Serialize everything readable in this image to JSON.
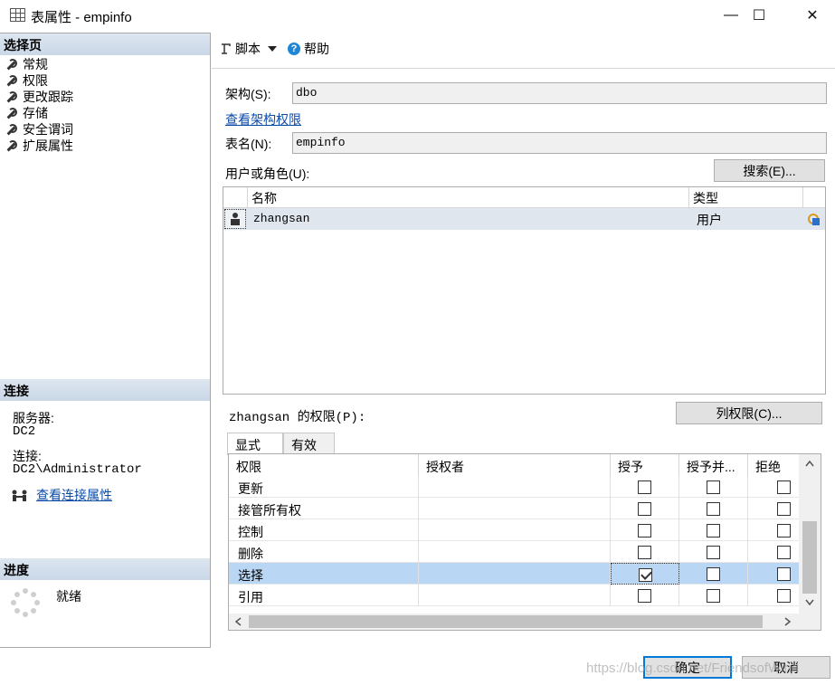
{
  "window": {
    "title": "表属性 - empinfo",
    "minimize_glyph": "—",
    "maximize_glyph": "☐",
    "close_glyph": "✕"
  },
  "left": {
    "select_page_header": "选择页",
    "pages": [
      "常规",
      "权限",
      "更改跟踪",
      "存储",
      "安全谓词",
      "扩展属性"
    ],
    "connection_header": "连接",
    "server_label": "服务器:",
    "server_value": "DC2",
    "connection_label": "连接:",
    "connection_value": "DC2\\Administrator",
    "view_connection_link": "查看连接属性",
    "progress_header": "进度",
    "progress_status": "就绪"
  },
  "toolbar": {
    "script_label": "脚本",
    "help_label": "帮助"
  },
  "form": {
    "schema_label": "架构(S):",
    "schema_value": "dbo",
    "view_schema_permissions_link": "查看架构权限",
    "table_name_label": "表名(N):",
    "table_name_value": "empinfo",
    "users_roles_label": "用户或角色(U):",
    "search_button": "搜索(E)...",
    "users_columns": [
      "名称",
      "类型"
    ],
    "users": [
      {
        "name": "zhangsan",
        "type": "用户"
      }
    ],
    "permissions_label": "zhangsan 的权限(P):",
    "column_permissions_button": "列权限(C)...",
    "tabs": [
      "显式",
      "有效"
    ],
    "perm_columns": [
      "权限",
      "授权者",
      "授予",
      "授予并...",
      "拒绝"
    ],
    "permissions": [
      {
        "name": "更新",
        "grantor": "",
        "grant": false,
        "with_grant": false,
        "deny": false
      },
      {
        "name": "接管所有权",
        "grantor": "",
        "grant": false,
        "with_grant": false,
        "deny": false
      },
      {
        "name": "控制",
        "grantor": "",
        "grant": false,
        "with_grant": false,
        "deny": false
      },
      {
        "name": "删除",
        "grantor": "",
        "grant": false,
        "with_grant": false,
        "deny": false
      },
      {
        "name": "选择",
        "grantor": "",
        "grant": true,
        "with_grant": false,
        "deny": false,
        "selected": true
      },
      {
        "name": "引用",
        "grantor": "",
        "grant": false,
        "with_grant": false,
        "deny": false
      }
    ]
  },
  "footer": {
    "ok_button": "确定",
    "cancel_button": "取消",
    "watermark": "https://blog.csdn.net/FriendsofWind"
  },
  "colors": {
    "selected_row": "#b9d7f4",
    "section_header": "#c9d7e7",
    "link": "#0b4ba8"
  }
}
